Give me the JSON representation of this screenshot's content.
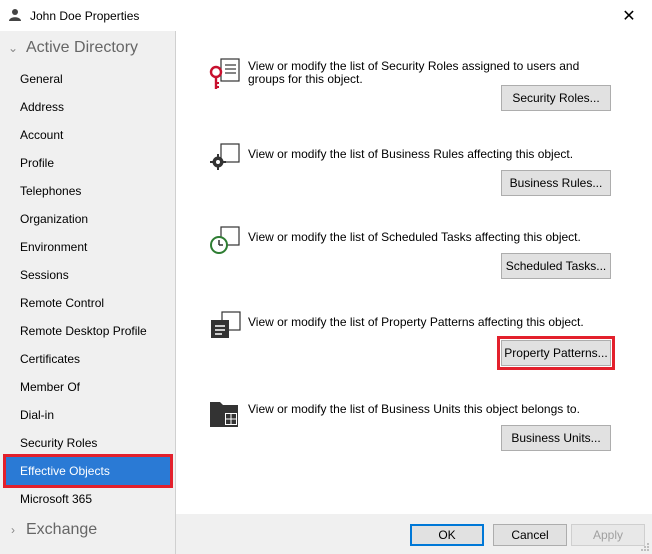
{
  "window": {
    "title": "John Doe Properties",
    "close_glyph": "✕"
  },
  "sidebar": {
    "groups": [
      {
        "label": "Active Directory",
        "expanded": true,
        "chevron": "⌄"
      },
      {
        "label": "Exchange",
        "expanded": false,
        "chevron": "›"
      }
    ],
    "items": [
      {
        "label": "General"
      },
      {
        "label": "Address"
      },
      {
        "label": "Account"
      },
      {
        "label": "Profile"
      },
      {
        "label": "Telephones"
      },
      {
        "label": "Organization"
      },
      {
        "label": "Environment"
      },
      {
        "label": "Sessions"
      },
      {
        "label": "Remote Control"
      },
      {
        "label": "Remote Desktop Profile"
      },
      {
        "label": "Certificates"
      },
      {
        "label": "Member Of"
      },
      {
        "label": "Dial-in"
      },
      {
        "label": "Security Roles"
      },
      {
        "label": "Effective Objects",
        "selected": true
      },
      {
        "label": "Microsoft 365"
      }
    ]
  },
  "sections": [
    {
      "icon": "security-roles-icon",
      "description": "View or modify the list of Security Roles assigned to users and groups for this object.",
      "button": "Security Roles..."
    },
    {
      "icon": "business-rules-icon",
      "description": "View or modify the list of Business Rules affecting this object.",
      "button": "Business Rules..."
    },
    {
      "icon": "scheduled-tasks-icon",
      "description": "View or modify the list of Scheduled Tasks affecting this object.",
      "button": "Scheduled Tasks..."
    },
    {
      "icon": "property-patterns-icon",
      "description": "View or modify the list of Property Patterns affecting this object.",
      "button": "Property Patterns..."
    },
    {
      "icon": "business-units-icon",
      "description": "View or modify the list of Business Units this object belongs to.",
      "button": "Business Units..."
    }
  ],
  "footer": {
    "ok": "OK",
    "cancel": "Cancel",
    "apply": "Apply"
  },
  "colors": {
    "selection": "#2a7ad5",
    "highlight_border": "#e3202c",
    "key_red": "#c8102e",
    "clock_green": "#2e7d32"
  }
}
